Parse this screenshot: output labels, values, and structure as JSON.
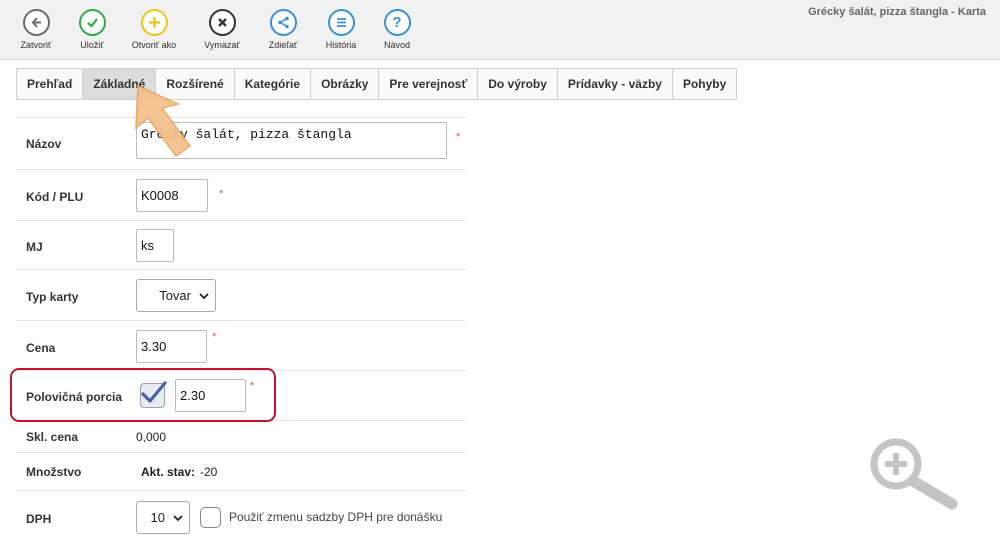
{
  "window_title": "Grécky šalát, pizza štangla - Karta",
  "toolbar": {
    "close": "Zatvoriť",
    "save": "Uložiť",
    "open_as": "Otvoriť ako",
    "delete": "Vymazať",
    "share": "Zdieľať",
    "history": "História",
    "help": "Návod"
  },
  "tabs": [
    "Prehľad",
    "Základné",
    "Rozšírené",
    "Kategórie",
    "Obrázky",
    "Pre verejnosť",
    "Do výroby",
    "Prídavky - väzby",
    "Pohyby"
  ],
  "active_tab": "Základné",
  "form": {
    "name_label": "Názov",
    "name_value": "Grécky šalát, pizza štangla",
    "code_label": "Kód / PLU",
    "code_value": "K0008",
    "unit_label": "MJ",
    "unit_value": "ks",
    "type_label": "Typ karty",
    "type_value": "Tovar",
    "price_label": "Cena",
    "price_value": "3.30",
    "half_label": "Polovičná porcia",
    "half_checked": true,
    "half_value": "2.30",
    "stock_price_label": "Skl. cena",
    "stock_price_value": "0,000",
    "quantity_label": "Množstvo",
    "quantity_state_label": "Akt. stav:",
    "quantity_value": "-20",
    "vat_label": "DPH",
    "vat_value": "10",
    "vat_change_label": "Použiť zmenu sadzby DPH pre donášku",
    "required_mark": "*"
  },
  "colors": {
    "close": "#6b6b6b",
    "save": "#2eaa4a",
    "open_as": "#f0c419",
    "delete": "#333333",
    "share": "#3a8fd6",
    "history": "#3a8fd6",
    "help": "#3a8fd6",
    "highlight": "#c8102e",
    "arrow": "#f5c08a"
  },
  "icons": [
    "arrow-left-icon",
    "check-icon",
    "plus-icon",
    "x-icon",
    "share-icon",
    "list-icon",
    "question-icon",
    "zoom-in-icon",
    "pointer-arrow-icon"
  ]
}
